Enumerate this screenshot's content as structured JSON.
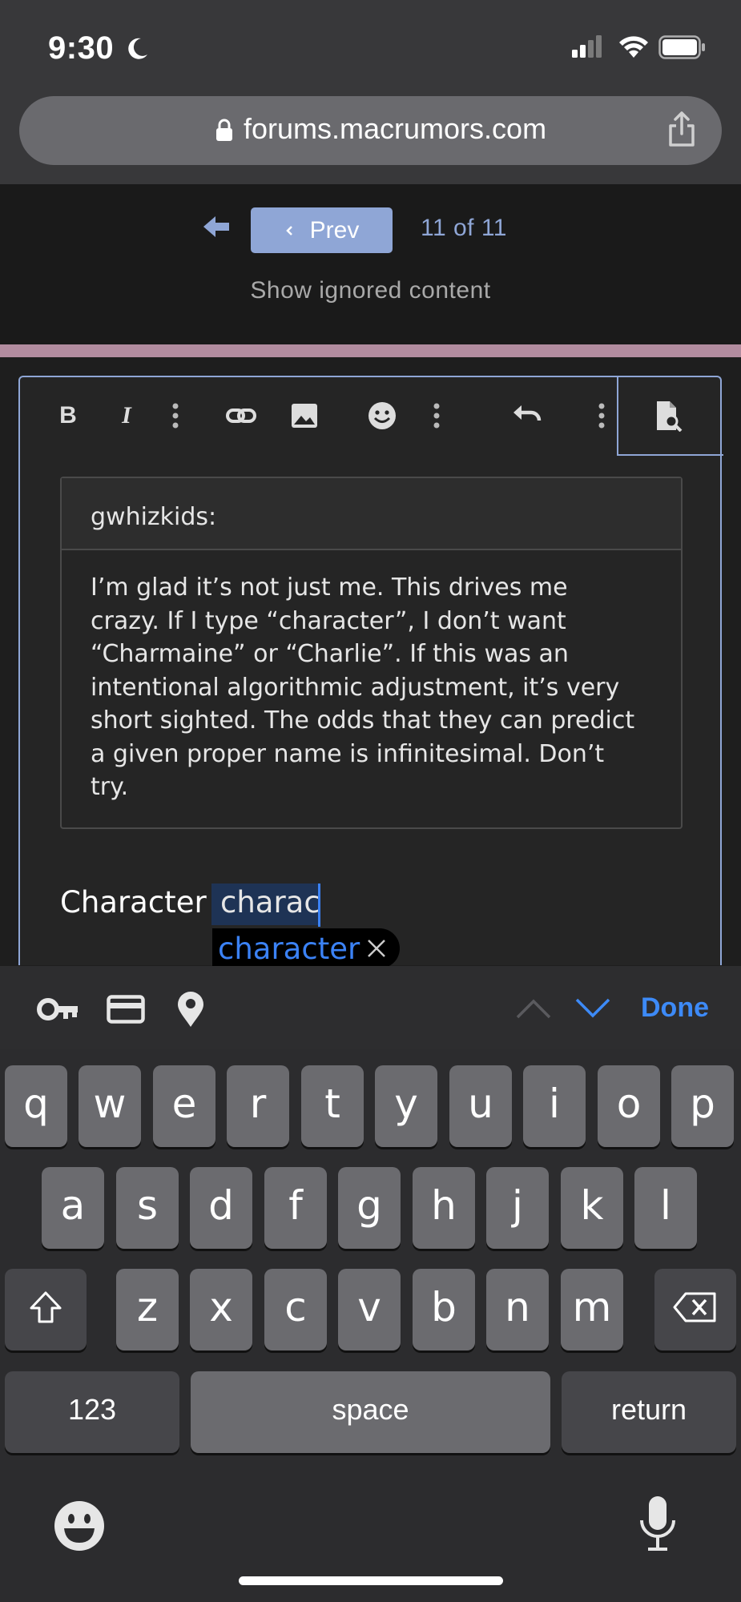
{
  "status_bar": {
    "time": "9:30"
  },
  "url_bar": {
    "url": "forums.macrumors.com"
  },
  "pagination": {
    "prev_label": "Prev",
    "page_count": "11 of 11"
  },
  "show_ignored": "Show ignored content",
  "editor_toolbar": {
    "bold": "B",
    "italic": "I"
  },
  "quote": {
    "author": "gwhizkids:",
    "lines": [
      "I’m glad it’s not just me. This drives me",
      "crazy. If I type “character”, I don’t want",
      "“Charmaine” or “Charlie”. If this was an",
      "intentional algorithmic adjustment, it’s very",
      "short sighted. The odds that they can predict",
      "a given proper name is infinitesimal. Don’t",
      "try."
    ]
  },
  "composer": {
    "typed_word": "Character",
    "typing_fragment": "charac",
    "autocorrect_suggestion": "character"
  },
  "accessory_bar": {
    "done_label": "Done"
  },
  "keyboard": {
    "row1": [
      "q",
      "w",
      "e",
      "r",
      "t",
      "y",
      "u",
      "i",
      "o",
      "p"
    ],
    "row2": [
      "a",
      "s",
      "d",
      "f",
      "g",
      "h",
      "j",
      "k",
      "l"
    ],
    "row3": [
      "z",
      "x",
      "c",
      "v",
      "b",
      "n",
      "m"
    ],
    "numbers_label": "123",
    "space_label": "space",
    "return_label": "return"
  }
}
